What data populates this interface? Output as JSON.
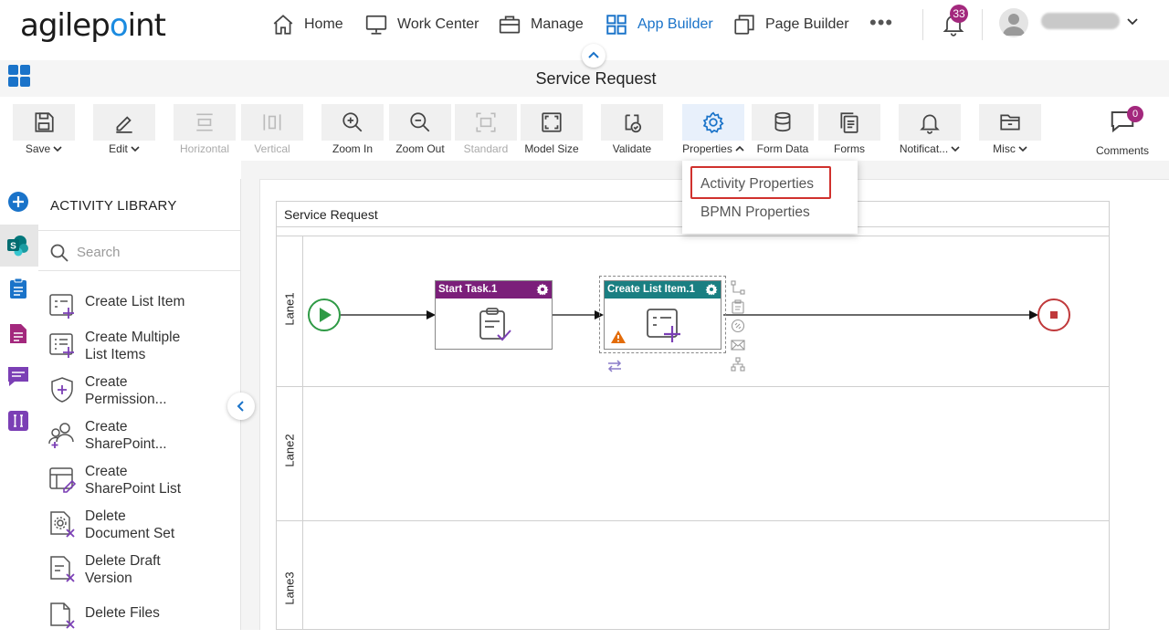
{
  "brand": {
    "logo_text_before_dot": "agilep",
    "logo_text_after_dot": "int"
  },
  "nav": {
    "items": [
      {
        "label": "Home",
        "icon": "home-icon"
      },
      {
        "label": "Work Center",
        "icon": "monitor-icon"
      },
      {
        "label": "Manage",
        "icon": "briefcase-icon"
      },
      {
        "label": "App Builder",
        "icon": "app-grid-icon",
        "active": true
      },
      {
        "label": "Page Builder",
        "icon": "pages-icon"
      }
    ],
    "more_label": "•••",
    "notification_count": "33"
  },
  "page": {
    "title": "Service Request"
  },
  "toolbar": {
    "items": [
      {
        "label": "Save",
        "icon": "save-icon",
        "has_menu": true
      },
      {
        "label": "Edit",
        "icon": "pencil-icon",
        "has_menu": true
      },
      {
        "label": "Horizontal",
        "icon": "horizontal-icon",
        "disabled": true
      },
      {
        "label": "Vertical",
        "icon": "vertical-icon",
        "disabled": true
      },
      {
        "label": "Zoom In",
        "icon": "zoom-in-icon"
      },
      {
        "label": "Zoom Out",
        "icon": "zoom-out-icon"
      },
      {
        "label": "Standard",
        "icon": "standard-icon",
        "disabled": true
      },
      {
        "label": "Model Size",
        "icon": "model-size-icon"
      },
      {
        "label": "Validate",
        "icon": "validate-icon"
      },
      {
        "label": "Properties",
        "icon": "gear-icon",
        "has_menu": true,
        "open": true
      },
      {
        "label": "Form Data",
        "icon": "database-icon"
      },
      {
        "label": "Forms",
        "icon": "forms-icon"
      },
      {
        "label": "Notificat...",
        "icon": "bell-icon",
        "has_menu": true
      },
      {
        "label": "Misc",
        "icon": "folder-icon",
        "has_menu": true
      }
    ],
    "comments_label": "Comments",
    "comments_count": "0"
  },
  "properties_menu": {
    "items": [
      "Activity Properties",
      "BPMN Properties"
    ],
    "highlighted": "Activity Properties"
  },
  "library": {
    "title": "ACTIVITY LIBRARY",
    "search_placeholder": "Search",
    "items": [
      {
        "line1": "Create List Item",
        "line2": ""
      },
      {
        "line1": "Create Multiple",
        "line2": "List Items"
      },
      {
        "line1": "Create",
        "line2": "Permission..."
      },
      {
        "line1": "Create",
        "line2": "SharePoint..."
      },
      {
        "line1": "Create",
        "line2": "SharePoint List"
      },
      {
        "line1": "Delete",
        "line2": "Document Set"
      },
      {
        "line1": "Delete Draft",
        "line2": "Version"
      },
      {
        "line1": "Delete Files",
        "line2": ""
      }
    ]
  },
  "process": {
    "pool_title": "Service Request",
    "lanes": [
      "Lane1",
      "Lane2",
      "Lane3"
    ],
    "tasks": [
      {
        "title": "Start Task.1",
        "color": "#7b1f7a"
      },
      {
        "title": "Create List Item.1",
        "color": "#1a7f82"
      }
    ]
  },
  "colors": {
    "accent": "#1a73c9",
    "badge": "#a3287d",
    "start_event": "#2e9a45",
    "end_event": "#c0393b",
    "highlight_box": "#d0312d"
  }
}
